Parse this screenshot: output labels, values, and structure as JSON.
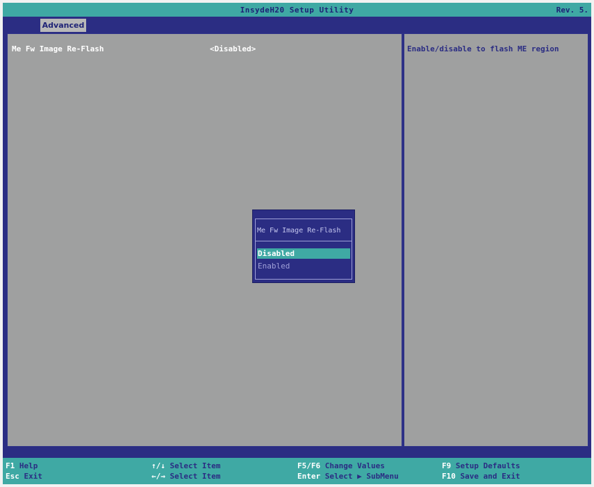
{
  "titlebar": {
    "title": "InsydeH20 Setup Utility",
    "rev": "Rev. 5."
  },
  "menu": {
    "active_tab": "Advanced"
  },
  "settings": [
    {
      "label": "Me Fw Image Re-Flash",
      "value": "<Disabled>"
    }
  ],
  "help": {
    "text": "Enable/disable to flash ME region"
  },
  "dialog": {
    "title": "Me Fw Image Re-Flash",
    "options": [
      "Disabled",
      "Enabled"
    ],
    "selected": "Disabled"
  },
  "footer": {
    "hints": [
      {
        "key": "F1",
        "desc": "Help"
      },
      {
        "key": "Esc",
        "desc": "Exit"
      },
      {
        "key": "↑/↓",
        "desc": "Select Item"
      },
      {
        "key": "←/→",
        "desc": "Select Item"
      },
      {
        "key": "F5/F6",
        "desc": "Change Values"
      },
      {
        "key": "Enter",
        "desc": "Select ▶ SubMenu"
      },
      {
        "key": "F9",
        "desc": "Setup Defaults"
      },
      {
        "key": "F10",
        "desc": "Save and Exit"
      }
    ]
  },
  "colors": {
    "blue": "#2b2d83",
    "teal": "#3fa9a4",
    "gray": "#9fa0a0",
    "white": "#ffffff"
  }
}
